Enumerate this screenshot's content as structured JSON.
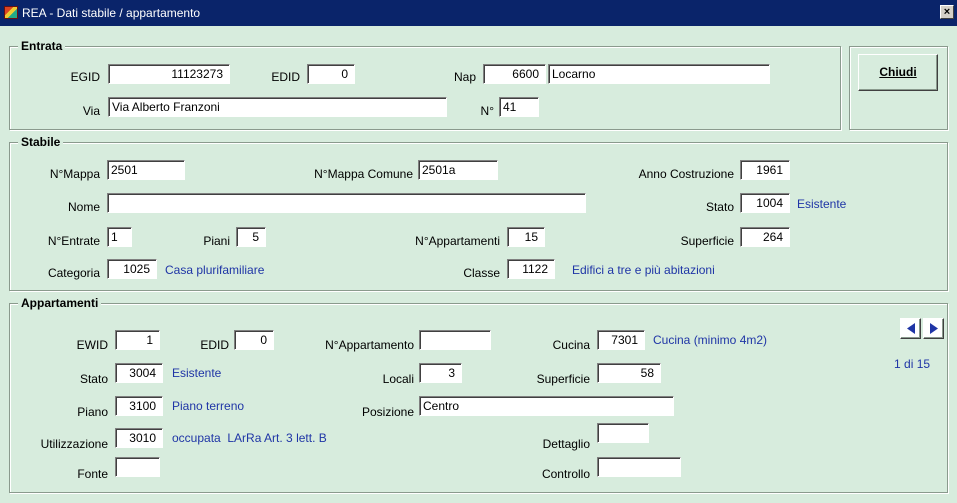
{
  "window": {
    "title": "REA - Dati stabile / appartamento",
    "close_label": "×"
  },
  "entrata": {
    "title": "Entrata",
    "egid_label": "EGID",
    "egid": "11123273",
    "edid_label": "EDID",
    "edid": "0",
    "nap_label": "Nap",
    "nap": "6600",
    "localita": "Locarno",
    "via_label": "Via",
    "via": "Via Alberto Franzoni",
    "numero_label": "N°",
    "numero": "41"
  },
  "actions": {
    "chiudi_label": "Chiudi"
  },
  "stabile": {
    "title": "Stabile",
    "nmappa_label": "N°Mappa",
    "nmappa": "2501",
    "nmappa_comune_label": "N°Mappa Comune",
    "nmappa_comune": "2501a",
    "anno_label": "Anno Costruzione",
    "anno": "1961",
    "nome_label": "Nome",
    "nome": "",
    "stato_label": "Stato",
    "stato_code": "1004",
    "stato_desc": "Esistente",
    "nentrate_label": "N°Entrate",
    "nentrate": "1",
    "piani_label": "Piani",
    "piani": "5",
    "nappartamenti_label": "N°Appartamenti",
    "nappartamenti": "15",
    "superficie_label": "Superficie",
    "superficie": "264",
    "categoria_label": "Categoria",
    "categoria_code": "1025",
    "categoria_desc": "Casa plurifamiliare",
    "classe_label": "Classe",
    "classe_code": "1122",
    "classe_desc": "Edifici a tre e più abitazioni"
  },
  "appartamenti": {
    "title": "Appartamenti",
    "ewid_label": "EWID",
    "ewid": "1",
    "edid_label": "EDID",
    "edid": "0",
    "nappartamento_label": "N°Appartamento",
    "nappartamento": "",
    "cucina_label": "Cucina",
    "cucina_code": "7301",
    "cucina_desc": "Cucina (minimo 4m2)",
    "stato_label": "Stato",
    "stato_code": "3004",
    "stato_desc": "Esistente",
    "locali_label": "Locali",
    "locali": "3",
    "superficie_label": "Superficie",
    "superficie": "58",
    "piano_label": "Piano",
    "piano_code": "3100",
    "piano_desc": "Piano terreno",
    "posizione_label": "Posizione",
    "posizione": "Centro",
    "utilizzazione_label": "Utilizzazione",
    "utilizzazione_code": "3010",
    "utilizzazione_desc": "occupata  LArRa Art. 3 lett. B",
    "dettaglio_label": "Dettaglio",
    "dettaglio": "",
    "fonte_label": "Fonte",
    "fonte": "",
    "controllo_label": "Controllo",
    "controllo": "",
    "pager": {
      "current": "1",
      "sep": "di",
      "total": "15"
    }
  },
  "icons": {
    "prev": "triangle-left-icon",
    "next": "triangle-right-icon",
    "app": "app-icon",
    "close": "close-icon"
  },
  "colors": {
    "background": "#d7ecdd",
    "titlebar": "#0a246a",
    "description_text": "#1f35a6",
    "nav_arrow": "#1f35a6"
  }
}
